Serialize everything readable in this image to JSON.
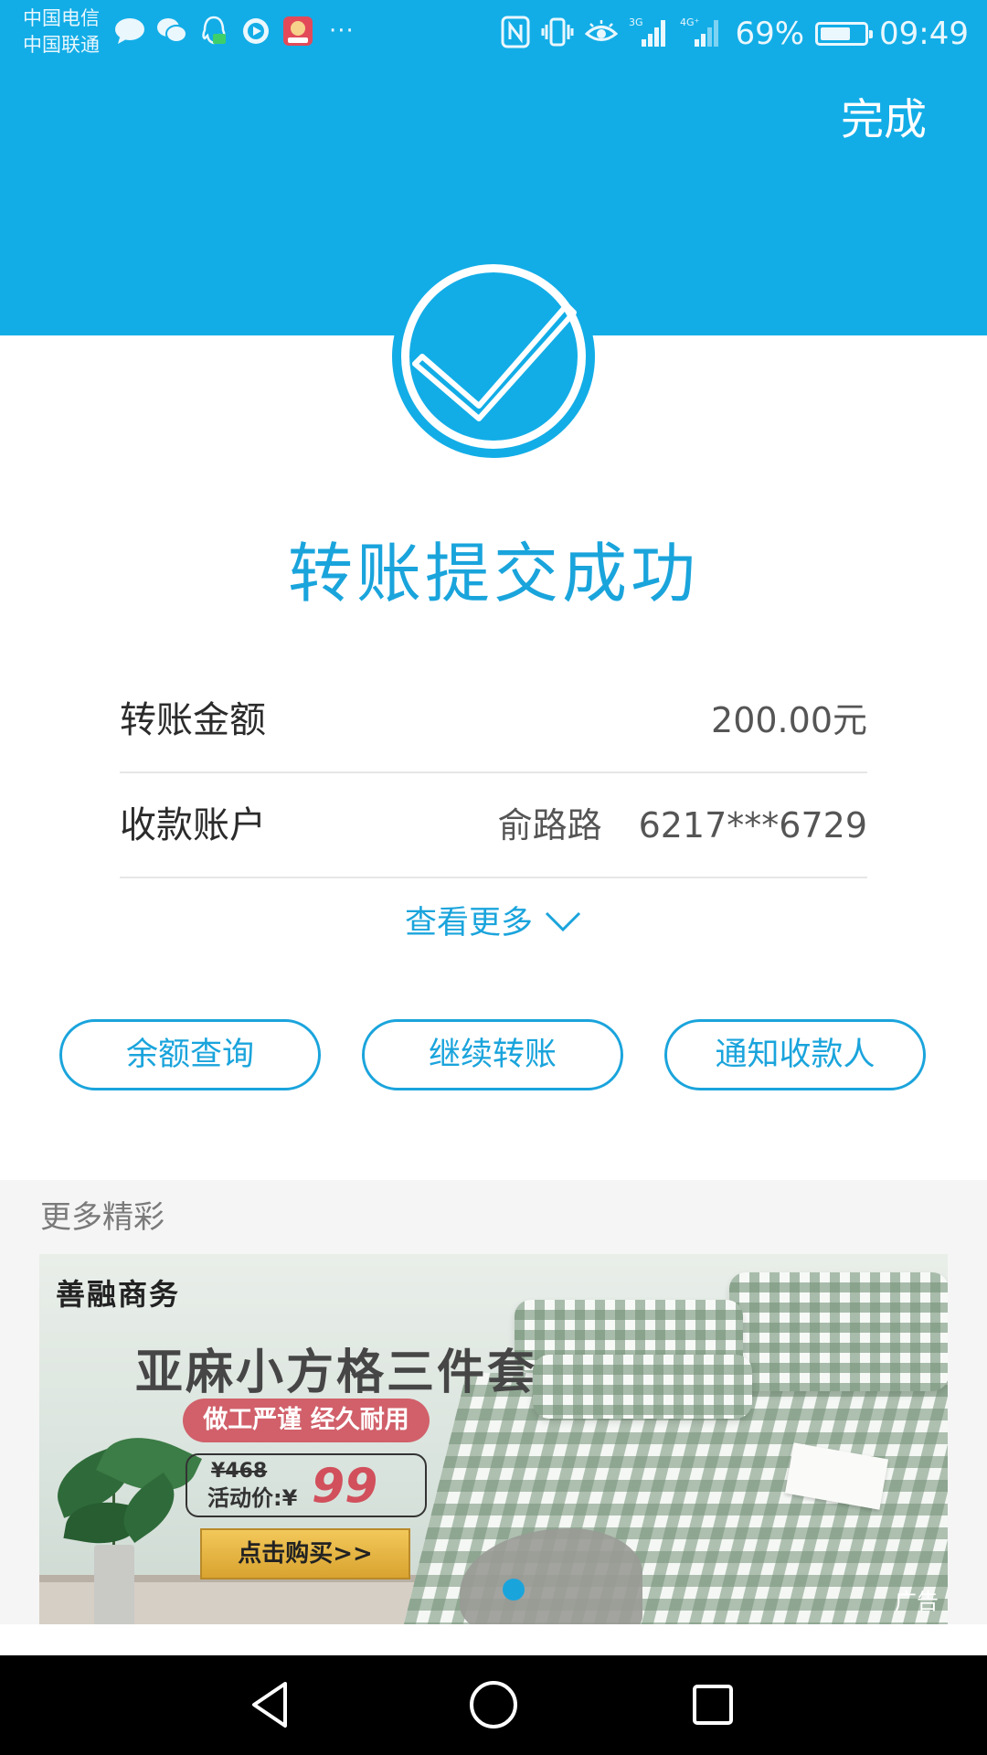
{
  "status_bar": {
    "carrier_1": "中国电信",
    "carrier_2": "中国联通",
    "notification_icons": [
      "message-bubble-icon",
      "wechat-icon",
      "qq-icon",
      "video-player-icon",
      "app-icon"
    ],
    "more": "···",
    "system_icons": [
      "nfc-icon",
      "vibrate-icon",
      "eye-comfort-icon",
      "signal-3g-icon",
      "signal-4g-icon"
    ],
    "battery_percent": "69%",
    "battery_level": 0.69,
    "time": "09:49"
  },
  "header": {
    "done_label": "完成"
  },
  "result": {
    "title": "转账提交成功",
    "icon": "checkmark-circle-icon"
  },
  "details": {
    "amount_label": "转账金额",
    "amount_value": "200.00元",
    "account_label": "收款账户",
    "account_name": "俞路路",
    "account_number": "6217***6729"
  },
  "view_more": {
    "label": "查看更多"
  },
  "actions": {
    "balance_query": "余额查询",
    "continue_transfer": "继续转账",
    "notify_payee": "通知收款人"
  },
  "more_section": {
    "title": "更多精彩",
    "ad": {
      "brand": "善融商务",
      "headline": "亚麻小方格三件套",
      "slogan": "做工严谨 经久耐用",
      "original_price": "¥468",
      "sale_label": "活动价:¥",
      "sale_price": "99",
      "buy_button": "点击购买>>",
      "ad_tag": "广告"
    }
  },
  "colors": {
    "primary_blue": "#12ade7",
    "accent_blue": "#1aa4dc",
    "promo_red": "#d1606a"
  },
  "nav_bar": {
    "icons": [
      "back-triangle-icon",
      "home-circle-icon",
      "recent-apps-square-icon"
    ]
  }
}
